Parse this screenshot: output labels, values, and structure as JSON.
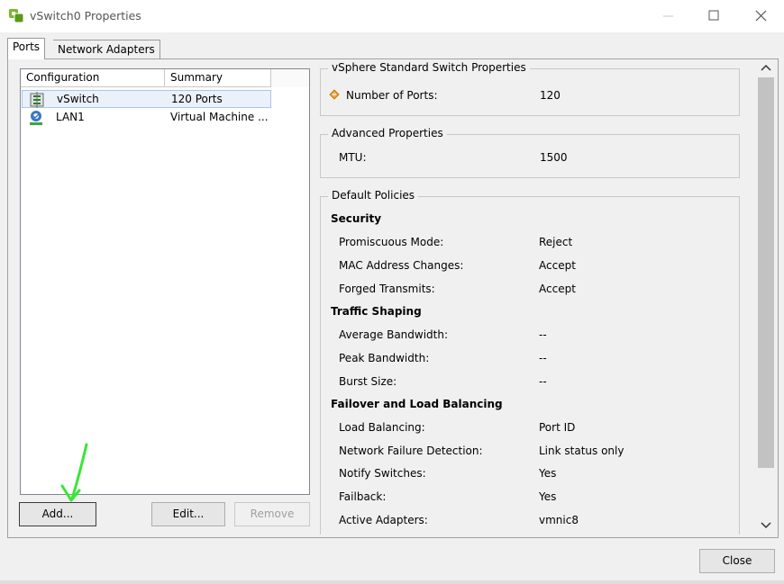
{
  "window": {
    "title": "vSwitch0 Properties"
  },
  "tabs": [
    {
      "label": "Ports",
      "active": true
    },
    {
      "label": "Network Adapters",
      "active": false
    }
  ],
  "port_list": {
    "columns": [
      "Configuration",
      "Summary"
    ],
    "rows": [
      {
        "icon": "vswitch-icon",
        "name": "vSwitch",
        "summary": "120 Ports",
        "selected": true
      },
      {
        "icon": "port-group-icon",
        "name": "LAN1",
        "summary": "Virtual Machine ...",
        "selected": false
      }
    ]
  },
  "buttons": {
    "add": "Add...",
    "edit": "Edit...",
    "remove": "Remove",
    "close": "Close"
  },
  "switch_properties": {
    "legend": "vSphere Standard Switch Properties",
    "items": [
      {
        "label": "Number of Ports:",
        "value": "120"
      }
    ]
  },
  "advanced_properties": {
    "legend": "Advanced Properties",
    "items": [
      {
        "label": "MTU:",
        "value": "1500"
      }
    ]
  },
  "default_policies": {
    "legend": "Default Policies",
    "security": {
      "title": "Security",
      "items": [
        {
          "label": "Promiscuous Mode:",
          "value": "Reject"
        },
        {
          "label": "MAC Address Changes:",
          "value": "Accept"
        },
        {
          "label": "Forged Transmits:",
          "value": "Accept"
        }
      ]
    },
    "traffic_shaping": {
      "title": "Traffic Shaping",
      "items": [
        {
          "label": "Average Bandwidth:",
          "value": "--"
        },
        {
          "label": "Peak Bandwidth:",
          "value": "--"
        },
        {
          "label": "Burst Size:",
          "value": "--"
        }
      ]
    },
    "failover": {
      "title": "Failover and Load Balancing",
      "items": [
        {
          "label": "Load Balancing:",
          "value": "Port ID"
        },
        {
          "label": "Network Failure Detection:",
          "value": "Link status only"
        },
        {
          "label": "Notify Switches:",
          "value": "Yes"
        },
        {
          "label": "Failback:",
          "value": "Yes"
        },
        {
          "label": "Active Adapters:",
          "value": "vmnic8"
        }
      ]
    }
  },
  "colors": {
    "accent_selection": "#eaf1fa",
    "annotation_arrow": "#39e639",
    "vsphere_green": "#79b928"
  }
}
